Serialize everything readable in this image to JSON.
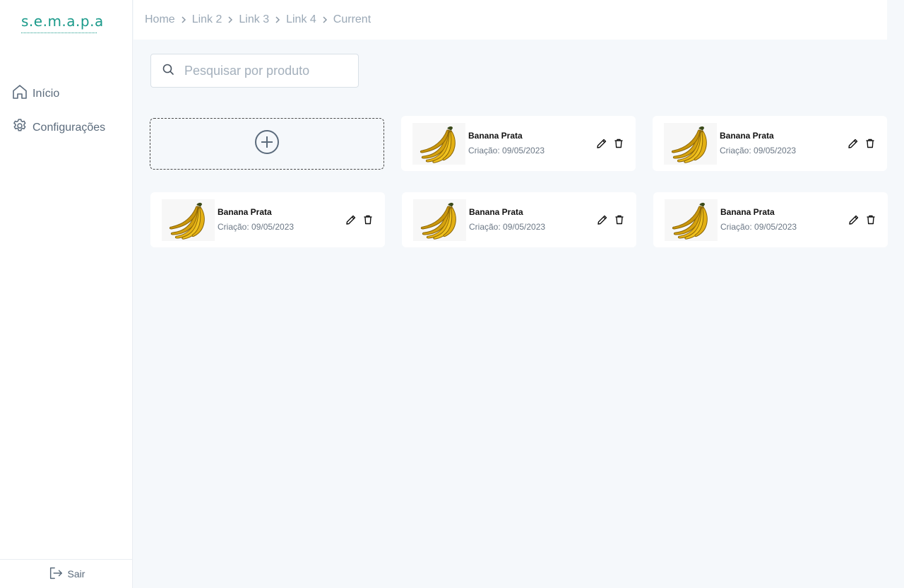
{
  "app": {
    "logo_text": "s.e.m.a.p.a",
    "brand_color": "#1a9a8a"
  },
  "sidebar": {
    "items": [
      {
        "label": "Início",
        "icon": "home-icon"
      },
      {
        "label": "Configurações",
        "icon": "gear-icon"
      }
    ],
    "logout_label": "Sair"
  },
  "breadcrumb": {
    "items": [
      "Home",
      "Link 2",
      "Link 3",
      "Link 4",
      "Current"
    ]
  },
  "search": {
    "placeholder": "Pesquisar por produto"
  },
  "products": [
    {
      "name": "Banana Prata",
      "date": "Criação: 09/05/2023"
    },
    {
      "name": "Banana Prata",
      "date": "Criação: 09/05/2023"
    },
    {
      "name": "Banana Prata",
      "date": "Criação: 09/05/2023"
    },
    {
      "name": "Banana Prata",
      "date": "Criação: 09/05/2023"
    },
    {
      "name": "Banana Prata",
      "date": "Criação: 09/05/2023"
    }
  ]
}
